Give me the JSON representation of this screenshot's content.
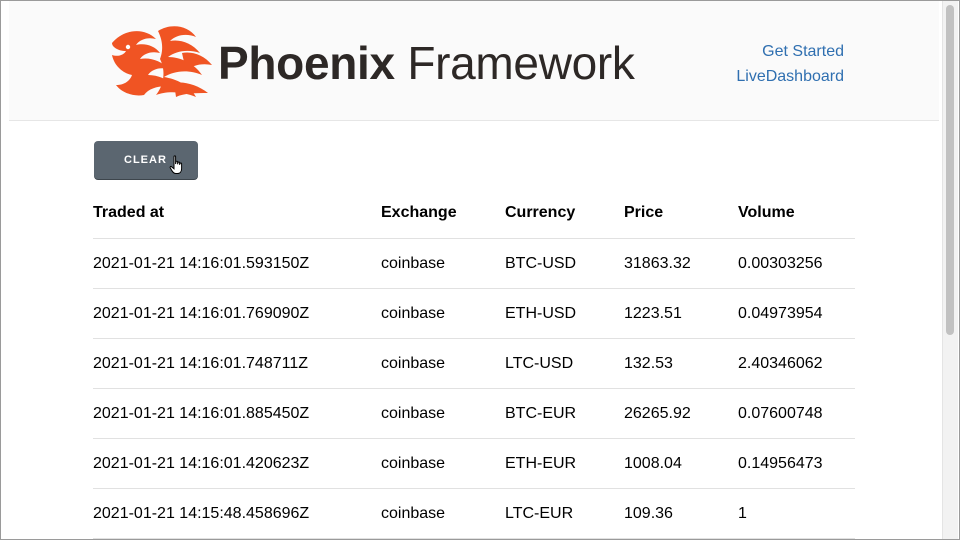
{
  "header": {
    "logo_bold": "Phoenix",
    "logo_light": "Framework",
    "nav": [
      {
        "label": "Get Started"
      },
      {
        "label": "LiveDashboard"
      }
    ]
  },
  "toolbar": {
    "clear_label": "CLEAR"
  },
  "table": {
    "columns": [
      "Traded at",
      "Exchange",
      "Currency",
      "Price",
      "Volume"
    ],
    "rows": [
      [
        "2021-01-21 14:16:01.593150Z",
        "coinbase",
        "BTC-USD",
        "31863.32",
        "0.00303256"
      ],
      [
        "2021-01-21 14:16:01.769090Z",
        "coinbase",
        "ETH-USD",
        "1223.51",
        "0.04973954"
      ],
      [
        "2021-01-21 14:16:01.748711Z",
        "coinbase",
        "LTC-USD",
        "132.53",
        "2.40346062"
      ],
      [
        "2021-01-21 14:16:01.885450Z",
        "coinbase",
        "BTC-EUR",
        "26265.92",
        "0.07600748"
      ],
      [
        "2021-01-21 14:16:01.420623Z",
        "coinbase",
        "ETH-EUR",
        "1008.04",
        "0.14956473"
      ],
      [
        "2021-01-21 14:15:48.458696Z",
        "coinbase",
        "LTC-EUR",
        "109.36",
        "1"
      ]
    ]
  },
  "colors": {
    "brand": "#f05423",
    "link": "#2f6fb0",
    "button": "#5b6670"
  },
  "icons": {
    "logo": "phoenix-bird-icon",
    "cursor": "hand-pointer-icon"
  }
}
